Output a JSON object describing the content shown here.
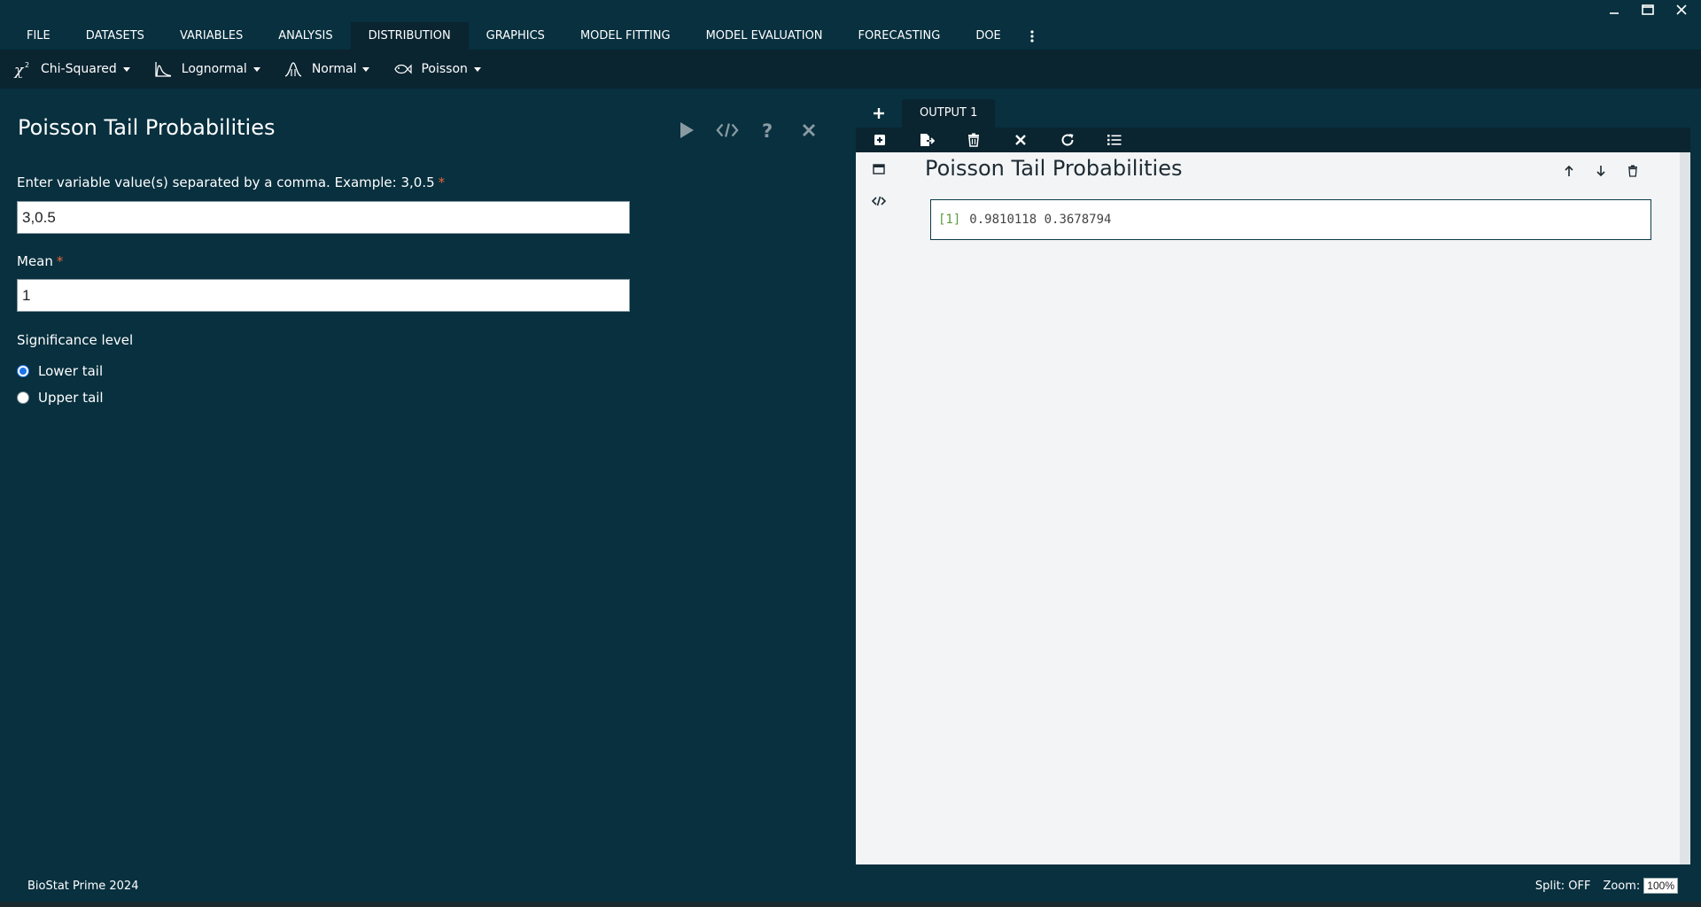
{
  "menu": {
    "items": [
      "FILE",
      "DATASETS",
      "VARIABLES",
      "ANALYSIS",
      "DISTRIBUTION",
      "GRAPHICS",
      "MODEL FITTING",
      "MODEL EVALUATION",
      "FORECASTING",
      "DOE"
    ],
    "active": "DISTRIBUTION",
    "more_icon": "vertical-ellipsis-icon"
  },
  "window_controls": [
    "minimize-icon",
    "maximize-icon",
    "close-icon"
  ],
  "submenu": {
    "chi_squared": {
      "label": "Chi-Squared",
      "icon": "chi-squared-icon"
    },
    "lognormal": {
      "label": "Lognormal",
      "icon": "lognormal-curve-icon"
    },
    "normal": {
      "label": "Normal",
      "icon": "normal-curve-icon"
    },
    "poisson": {
      "label": "Poisson",
      "icon": "fish-icon"
    }
  },
  "dialog": {
    "title": "Poisson Tail Probabilities",
    "tools": [
      "run-icon",
      "code-icon",
      "help-icon",
      "close-icon"
    ],
    "values_label": "Enter variable value(s) separated by a comma. Example: 3,0.5",
    "values_value": "3,0.5",
    "mean_label": "Mean",
    "mean_value": "1",
    "required_mark": "*",
    "significance_label": "Significance level",
    "lower_tail_label": "Lower tail",
    "upper_tail_label": "Upper tail",
    "selected_tail": "Lower tail"
  },
  "output": {
    "add_tab_icon": "plus-icon",
    "tab_label": "OUTPUT 1",
    "toolbar_icons": [
      "add-box-icon",
      "export-icon",
      "trash-icon",
      "close-icon",
      "refresh-icon",
      "list-icon"
    ],
    "side_icons": [
      "window-icon",
      "code-icon"
    ],
    "title": "Poisson Tail Probabilities",
    "actions": [
      "arrow-up-icon",
      "arrow-down-icon",
      "trash-icon"
    ],
    "result_index": "[1]",
    "result_values": "0.9810118 0.3678794"
  },
  "status": {
    "app_name": "BioStat Prime 2024",
    "split": "Split: OFF",
    "zoom_label": "Zoom:",
    "zoom_value": "100%"
  },
  "colors": {
    "background": "#08303f",
    "toolbar": "#0a2430",
    "output_bg": "#f3f4f6",
    "required": "#e8643a",
    "radio_selected": "#1a73e8"
  }
}
